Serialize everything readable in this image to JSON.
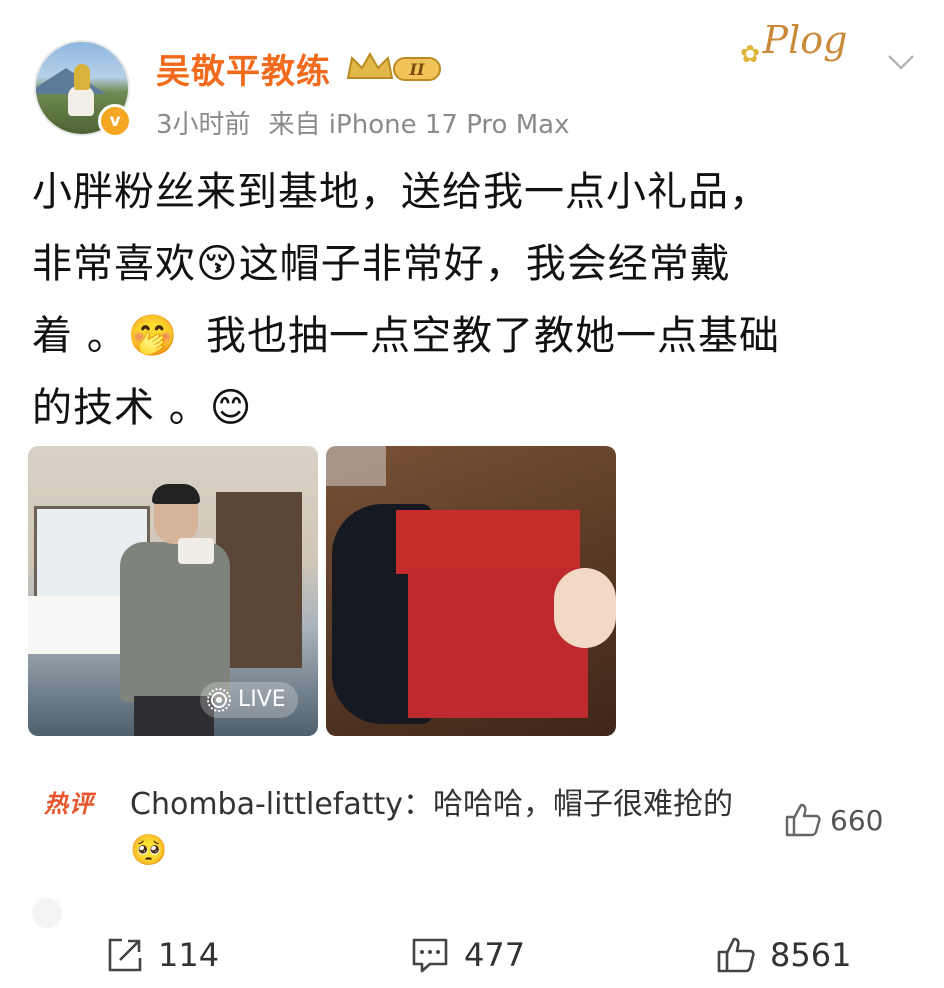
{
  "post": {
    "username": "吴敬平教练",
    "member_level": "II",
    "verified_badge": "v",
    "time": "3小时前",
    "source": "来自 iPhone 17 Pro Max",
    "text": "小胖粉丝来到基地，送给我一点小礼品，\n非常喜欢😚这帽子非常好，我会经常戴\n着 。🤭  我也抽一点空教了教她一点基础\n的技术 。😊",
    "decoration_sticker": "Plog",
    "photos": [
      {
        "badge": "LIVE",
        "live_icon": "live-photo-icon"
      },
      {}
    ]
  },
  "hot_comment": {
    "tag": "热评",
    "text": "Chomba-littlefatty：哈哈哈，帽子很难抢的🥺",
    "likes": "660"
  },
  "actions": {
    "share_count": "114",
    "comment_count": "477",
    "like_count": "8561"
  },
  "icons": {
    "share": "share-icon",
    "comment": "comment-icon",
    "like": "thumbs-up-icon",
    "more": "chevron-down-icon",
    "crown": "crown-icon"
  },
  "colors": {
    "username": "#f26a1b",
    "hot_tag": "#e8542c",
    "verified": "#f5a623",
    "meta": "#8a8a8a"
  }
}
